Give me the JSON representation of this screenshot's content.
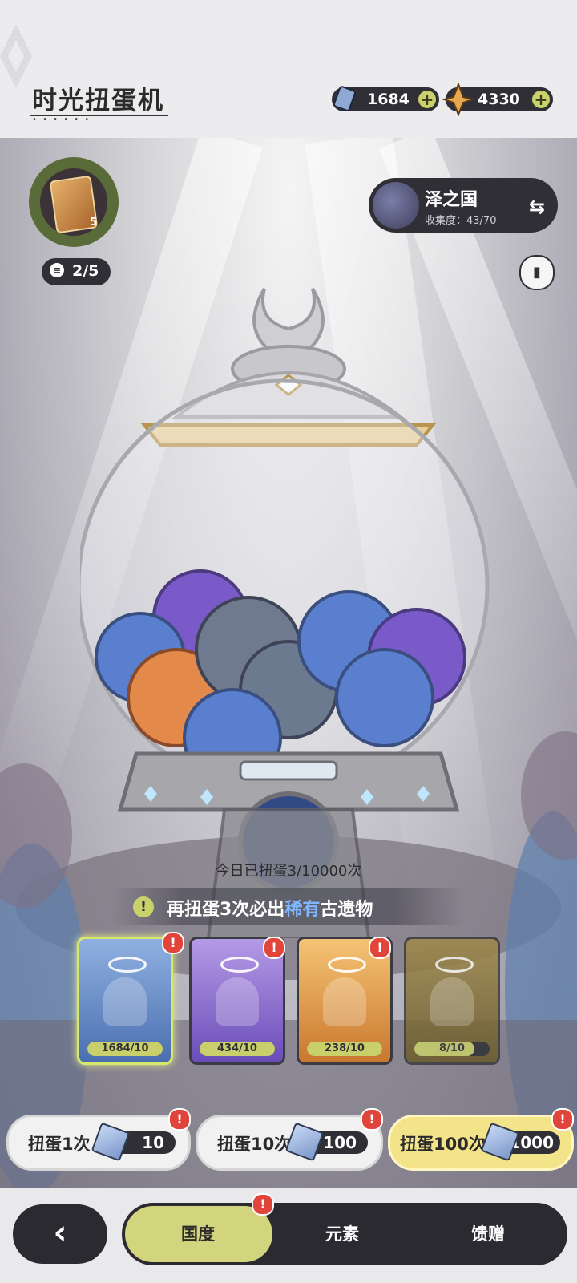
{
  "header": {
    "title": "时光扭蛋机",
    "currencies": [
      {
        "icon": "blue-crystal-icon",
        "amount": "1684"
      },
      {
        "icon": "gold-star-crystal-icon",
        "amount": "4330"
      }
    ]
  },
  "collection_ring": {
    "count": "5",
    "progress": "2/5"
  },
  "region": {
    "name": "泽之国",
    "progress": "收集度：43/70"
  },
  "draw_count": "今日已扭蛋3/10000次",
  "guarantee": {
    "before": "再扭蛋3次必出",
    "highlight": "稀有",
    "after": "古遗物"
  },
  "cards": [
    {
      "rarity": "blue",
      "label": "1684/10",
      "fill_fraction": 1.0
    },
    {
      "rarity": "purple",
      "label": "434/10",
      "fill_fraction": 1.0
    },
    {
      "rarity": "orange",
      "label": "238/10",
      "fill_fraction": 1.0
    },
    {
      "rarity": "gold",
      "label": "8/10",
      "fill_fraction": 0.8
    }
  ],
  "draw_buttons": [
    {
      "label": "扭蛋1次",
      "cost": "10"
    },
    {
      "label": "扭蛋10次",
      "cost": "100"
    },
    {
      "label": "扭蛋100次",
      "cost": "1000"
    }
  ],
  "badge_text": "!",
  "tabs": [
    {
      "label": "国度"
    },
    {
      "label": "元素"
    },
    {
      "label": "馈赠"
    }
  ],
  "colors": {
    "accent": "#c9d26a",
    "dark": "#2f2f35",
    "highlight": "#7fb6ff",
    "badge": "#e0443a"
  }
}
